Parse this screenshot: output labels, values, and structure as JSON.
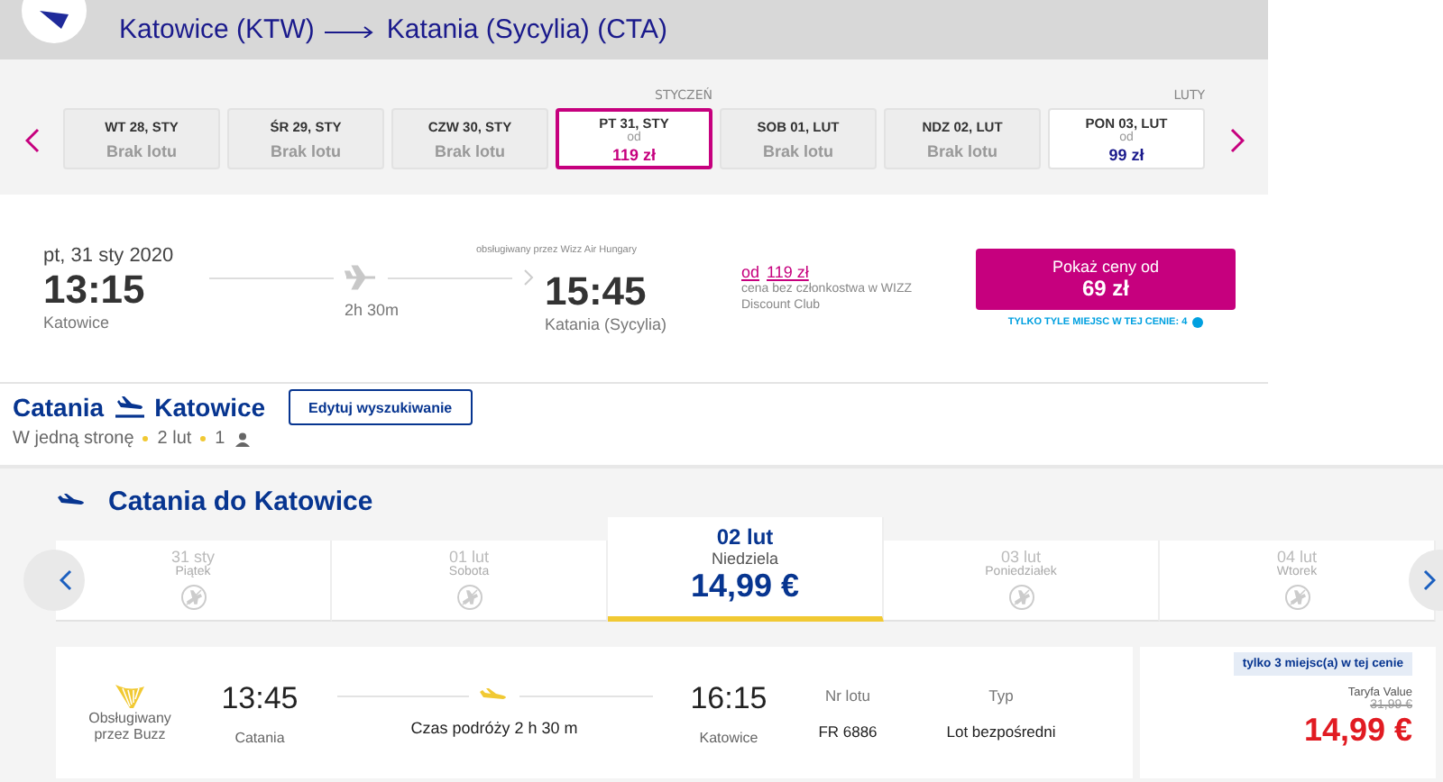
{
  "header": {
    "title_from": "Katowice (KTW)",
    "title_to": "Katania (Sycylia) (CTA)"
  },
  "date_strip": {
    "days": [
      {
        "label": "WT 28, STY",
        "kind": "none",
        "status": "Brak lotu",
        "selected": false
      },
      {
        "label": "ŚR 29, STY",
        "kind": "none",
        "status": "Brak lotu",
        "selected": false
      },
      {
        "label": "CZW 30, STY",
        "kind": "none",
        "status": "Brak lotu",
        "selected": false
      },
      {
        "label": "PT 31, STY",
        "kind": "price",
        "from": "od",
        "price": "119 zł",
        "selected": true,
        "month_label": "STYCZEŃ"
      },
      {
        "label": "SOB 01, LUT",
        "kind": "none",
        "status": "Brak lotu",
        "selected": false
      },
      {
        "label": "NDZ 02, LUT",
        "kind": "none",
        "status": "Brak lotu",
        "selected": false
      },
      {
        "label": "PON 03, LUT",
        "kind": "price",
        "from": "od",
        "price": "99 zł",
        "selected": false,
        "month_label": "LUTY"
      }
    ]
  },
  "flight": {
    "date": "pt, 31 sty 2020",
    "depart_time": "13:15",
    "depart_city": "Katowice",
    "duration": "2h 30m",
    "operator": "obsługiwany przez Wizz Air Hungary",
    "arrive_time": "15:45",
    "arrive_city": "Katania (Sycylia)",
    "member_from": "od",
    "member_price": "119 zł",
    "member_note": "cena bez członkostwa w WIZZ Discount Club",
    "button_top": "Pokaż ceny od",
    "button_price": "69 zł",
    "seats_note": "TYLKO TYLE MIEJSC W TEJ CENIE: 4"
  },
  "summary": {
    "from": "Catania",
    "to": "Katowice",
    "edit_button": "Edytuj wyszukiwanie",
    "trip_type": "W jedną stronę",
    "date": "2 lut",
    "passengers": "1"
  },
  "results": {
    "heading": "Catania do Katowice",
    "dates": [
      {
        "date": "31 sty",
        "day": "Piątek",
        "kind": "none",
        "selected": false
      },
      {
        "date": "01 lut",
        "day": "Sobota",
        "kind": "none",
        "selected": false
      },
      {
        "date": "02 lut",
        "day": "Niedziela",
        "kind": "price",
        "price": "14,99 €",
        "selected": true
      },
      {
        "date": "03 lut",
        "day": "Poniedziałek",
        "kind": "none",
        "selected": false
      },
      {
        "date": "04 lut",
        "day": "Wtorek",
        "kind": "none",
        "selected": false
      }
    ],
    "flight": {
      "operator": "Obsługiwany przez Buzz",
      "depart_time": "13:45",
      "depart_city": "Catania",
      "duration": "Czas podróży 2 h 30 m",
      "arrive_time": "16:15",
      "arrive_city": "Katowice",
      "flight_no_label": "Nr lotu",
      "flight_no": "FR 6886",
      "type_label": "Typ",
      "type": "Lot bezpośredni",
      "seats_badge": "tylko 3 miejsc(a) w tej cenie",
      "fare_name": "Taryfa Value",
      "old_price": "31,99 €",
      "price": "14,99 €"
    }
  }
}
